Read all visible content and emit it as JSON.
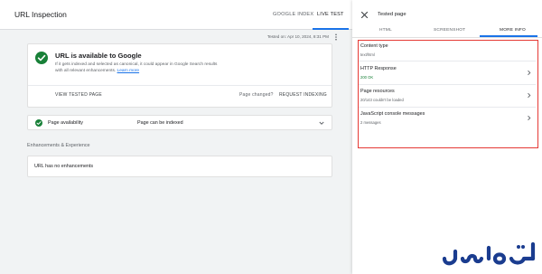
{
  "header": {
    "title": "URL Inspection",
    "tabs": [
      "GOOGLE INDEX",
      "LIVE TEST"
    ],
    "active_tab": "LIVE TEST"
  },
  "tested_on": "Tested on: Apr 10, 2024, 8:31 PM",
  "status_card": {
    "title": "URL is available to Google",
    "desc_line1": "If it gets indexed and selected as canonical, it could appear in Google Search results",
    "desc_line2_prefix": "with all relevant enhancements.",
    "learn_more": "Learn more",
    "view_tested_page": "VIEW TESTED PAGE",
    "page_changed": "Page changed?",
    "request_indexing": "REQUEST INDEXING"
  },
  "availability": {
    "label": "Page availability",
    "value": "Page can be indexed"
  },
  "enhancements": {
    "heading": "Enhancements & Experience",
    "empty": "URL has no enhancements"
  },
  "panel": {
    "title": "Tested page",
    "tabs": [
      "HTML",
      "SCREENSHOT",
      "MORE INFO"
    ],
    "active_tab": "MORE INFO",
    "rows": [
      {
        "title": "Content type",
        "sub": "text/html"
      },
      {
        "title": "HTTP Response",
        "sub": "200 OK"
      },
      {
        "title": "Page resources",
        "sub": "20/143 couldn't be loaded"
      },
      {
        "title": "JavaScript console messages",
        "sub": "2 messages"
      }
    ]
  },
  "colors": {
    "accent": "#1a73e8",
    "success": "#188038",
    "highlight": "#e53935",
    "watermark": "#1a3c8f"
  },
  "icons": {
    "status": "check-circle-icon",
    "close": "close-icon",
    "chevron": "chevron-right-icon",
    "expand": "chevron-down-icon",
    "more": "more-vert-icon"
  }
}
